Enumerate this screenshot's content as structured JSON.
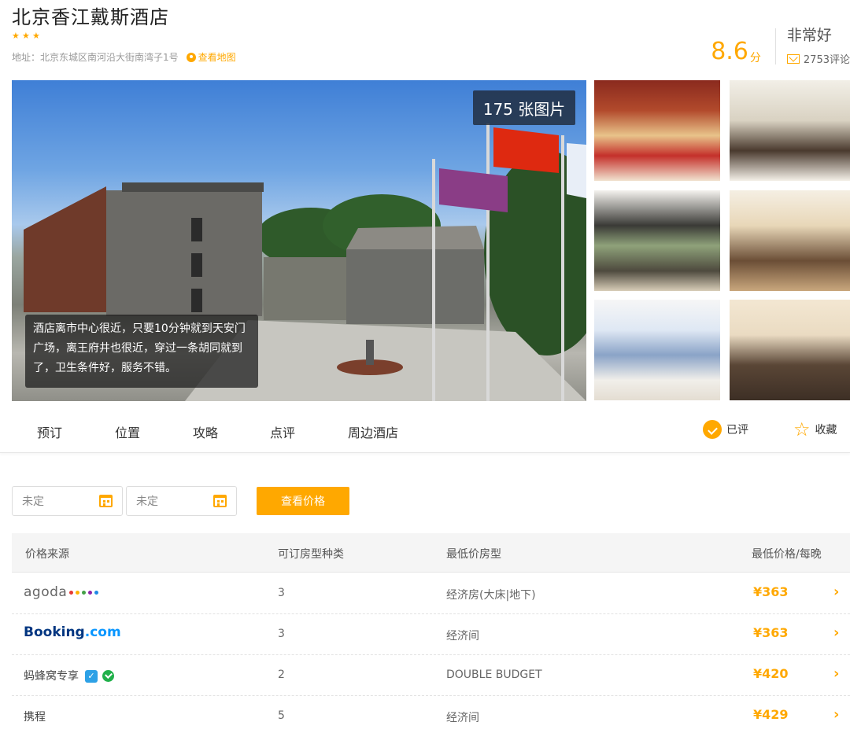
{
  "hotel": {
    "name": "北京香江戴斯酒店",
    "star_count": 3,
    "address": "地址：北京东城区南河沿大街南湾子1号",
    "map_link": "查看地图"
  },
  "rating": {
    "score": "8.6",
    "unit": "分",
    "word": "非常好",
    "reviews": "2753评论"
  },
  "gallery": {
    "photo_count": "175 张图片",
    "caption": "酒店离市中心很近，只要10分钟就到天安门广场，离王府井也很近，穿过一条胡同就到了，卫生条件好，服务不错。"
  },
  "nav": {
    "items": [
      "预订",
      "位置",
      "攻略",
      "点评",
      "周边酒店"
    ],
    "rated_label": "已评",
    "favorite_label": "收藏"
  },
  "search": {
    "checkin_value": "未定",
    "checkout_value": "未定",
    "button_label": "查看价格"
  },
  "table": {
    "headers": [
      "价格来源",
      "可订房型种类",
      "最低价房型",
      "最低价格/每晚"
    ],
    "rows": [
      {
        "source": "agoda",
        "count": "3",
        "room_type": "经济房(大床|地下)",
        "price": "¥363"
      },
      {
        "source": "Booking.com",
        "count": "3",
        "room_type": "经济间",
        "price": "¥363"
      },
      {
        "source": "蚂蜂窝专享",
        "count": "2",
        "room_type": "DOUBLE BUDGET",
        "price": "¥420"
      },
      {
        "source": "携程",
        "count": "5",
        "room_type": "经济间",
        "price": "¥429"
      }
    ]
  },
  "colors": {
    "accent": "#ffa800",
    "booking_dark": "#003580",
    "booking_light": "#0896ff"
  }
}
